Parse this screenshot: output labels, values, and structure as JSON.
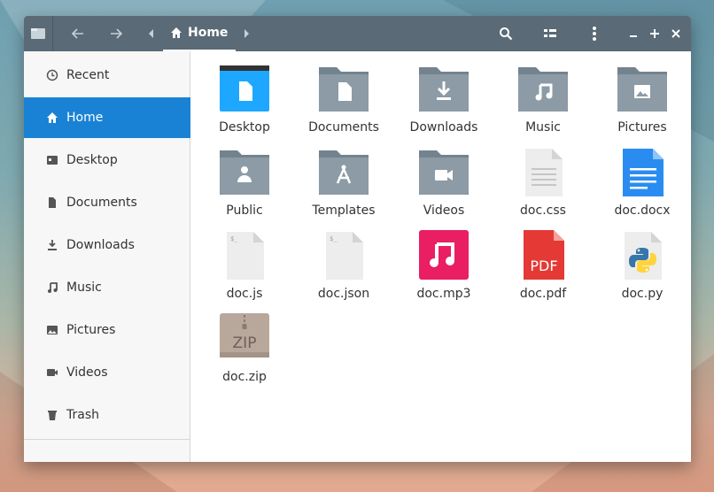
{
  "header": {
    "breadcrumb_home": "Home"
  },
  "sidebar": {
    "items": [
      {
        "label": "Recent"
      },
      {
        "label": "Home"
      },
      {
        "label": "Desktop"
      },
      {
        "label": "Documents"
      },
      {
        "label": "Downloads"
      },
      {
        "label": "Music"
      },
      {
        "label": "Pictures"
      },
      {
        "label": "Videos"
      },
      {
        "label": "Trash"
      }
    ]
  },
  "files": [
    {
      "label": "Desktop"
    },
    {
      "label": "Documents"
    },
    {
      "label": "Downloads"
    },
    {
      "label": "Music"
    },
    {
      "label": "Pictures"
    },
    {
      "label": "Public"
    },
    {
      "label": "Templates"
    },
    {
      "label": "Videos"
    },
    {
      "label": "doc.css"
    },
    {
      "label": "doc.docx"
    },
    {
      "label": "doc.js"
    },
    {
      "label": "doc.json"
    },
    {
      "label": "doc.mp3"
    },
    {
      "label": "doc.pdf"
    },
    {
      "label": "doc.py"
    },
    {
      "label": "doc.zip"
    }
  ],
  "thumb_text": {
    "pdf": "PDF",
    "zip": "ZIP",
    "script": "$_"
  },
  "colors": {
    "headerbar": "#5a6a76",
    "selection": "#1a82d4",
    "folder": "#8c9ba5",
    "folder_dark": "#73838e",
    "desktop_folder": "#1ea7ff",
    "docx": "#2a8cf0",
    "mp3": "#e91e63",
    "pdf": "#e53935",
    "zip": "#b8a79b"
  }
}
